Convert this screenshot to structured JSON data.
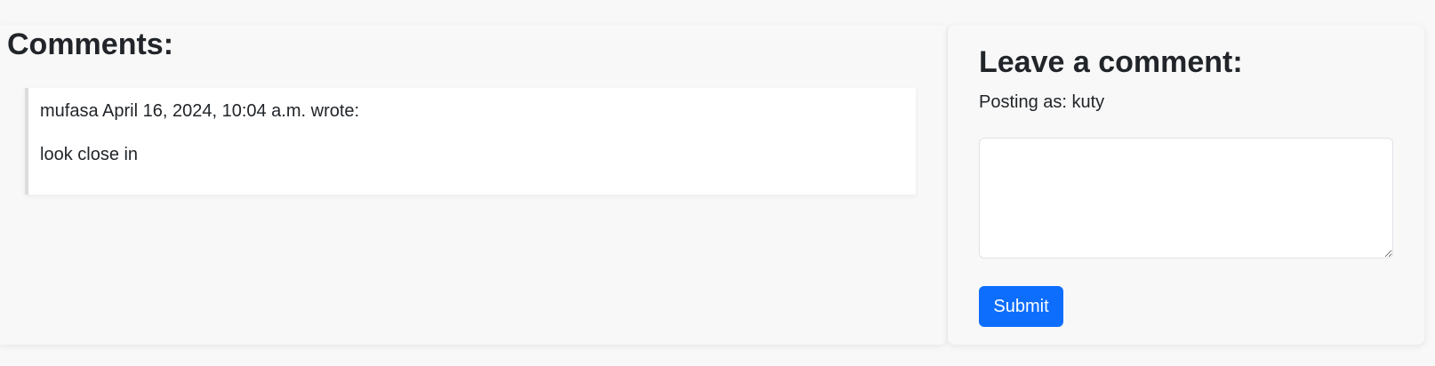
{
  "comments": {
    "title": "Comments:",
    "items": [
      {
        "meta": "mufasa April 16, 2024, 10:04 a.m. wrote:",
        "body": "look close in"
      }
    ]
  },
  "form": {
    "title": "Leave a comment:",
    "posting_as": "Posting as: kuty",
    "textarea_value": "",
    "submit_label": "Submit"
  },
  "colors": {
    "accent": "#0d6efd",
    "background": "#f8f8f8"
  }
}
